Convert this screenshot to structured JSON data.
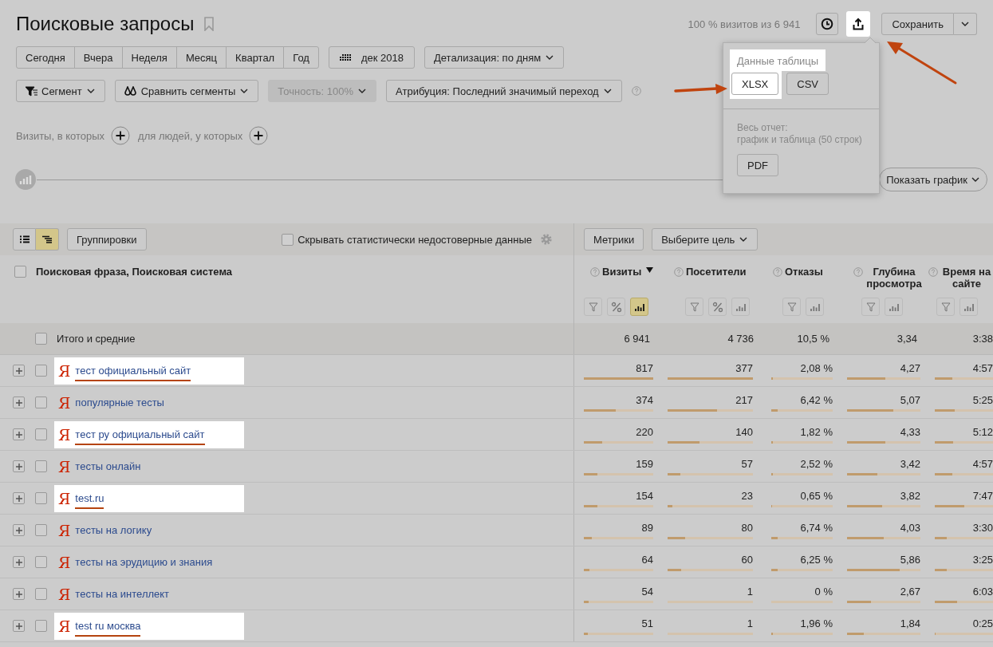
{
  "title": "Поисковые запросы",
  "summary": "100 % визитов из 6 941",
  "export_button": {
    "highlighted": true
  },
  "save_button": "Сохранить",
  "period_tabs": [
    {
      "label": "Сегодня",
      "selected": false
    },
    {
      "label": "Вчера",
      "selected": false
    },
    {
      "label": "Неделя",
      "selected": false
    },
    {
      "label": "Месяц",
      "selected": false
    },
    {
      "label": "Квартал",
      "selected": false
    },
    {
      "label": "Год",
      "selected": false
    }
  ],
  "date_button": "дек 2018",
  "detail_dropdown": "Детализация: по дням",
  "filters": [
    {
      "label": "Сегмент",
      "kind": "segment",
      "disabled": false
    },
    {
      "label": "Сравнить сегменты",
      "kind": "compare",
      "disabled": false
    },
    {
      "label": "Точность: 100%",
      "kind": "plain",
      "disabled": true
    },
    {
      "label": "Атрибуция: Последний значимый переход",
      "kind": "plain",
      "disabled": false
    }
  ],
  "segment_builder": {
    "visits_label": "Визиты, в которых",
    "people_label": "для людей, у которых"
  },
  "chart_toggle": "Показать график",
  "export_menu": {
    "table_title": "Данные таблицы",
    "table_title_highlighted": true,
    "formats": [
      {
        "label": "XLSX",
        "highlighted": true
      },
      {
        "label": "CSV",
        "highlighted": false
      }
    ],
    "report_lines": [
      "Весь отчет:",
      "график и таблица (50 строк)"
    ],
    "report_format": "PDF"
  },
  "table_toolbar": {
    "view_modes": [
      {
        "kind": "list",
        "selected": false
      },
      {
        "kind": "tree",
        "selected": true
      }
    ],
    "groupings_button": "Группировки",
    "hide_unreliable": {
      "label": "Скрывать статистически недостоверные данные",
      "checked": false
    },
    "metrics_button": "Метрики",
    "goal_dropdown": "Выберите цель"
  },
  "table": {
    "select_all_checked": false,
    "dimension_header": "Поисковая фраза, Поисковая система",
    "columns": [
      {
        "label": "Визиты",
        "sorted": true,
        "tools": [
          {
            "kind": "filter",
            "active": false
          },
          {
            "kind": "percent",
            "active": false
          },
          {
            "kind": "bars",
            "active": true
          }
        ]
      },
      {
        "label": "Посетители",
        "sorted": false,
        "tools": [
          {
            "kind": "filter",
            "active": false
          },
          {
            "kind": "percent",
            "active": false
          },
          {
            "kind": "bars",
            "active": false
          }
        ]
      },
      {
        "label": "Отказы",
        "sorted": false,
        "tools": [
          {
            "kind": "filter",
            "active": false
          },
          {
            "kind": "bars",
            "active": false
          }
        ]
      },
      {
        "label": "Глубина просмотра",
        "sorted": false,
        "tools": [
          {
            "kind": "filter",
            "active": false
          },
          {
            "kind": "bars",
            "active": false
          }
        ]
      },
      {
        "label": "Время на сайте",
        "sorted": false,
        "tools": [
          {
            "kind": "filter",
            "active": false
          },
          {
            "kind": "bars",
            "active": false
          }
        ]
      }
    ],
    "totals": {
      "checked": false,
      "label": "Итого и средние",
      "values": [
        "6 941",
        "4 736",
        "10,5 %",
        "3,34",
        "3:38"
      ]
    },
    "rows": [
      {
        "checked": false,
        "engine_icon": "Я",
        "phrase": "тест официальный сайт",
        "annotated": true,
        "cells": [
          {
            "value": "817",
            "level": 1
          },
          {
            "value": "377",
            "level": 1
          },
          {
            "value": "2,08 %",
            "level": 0.03
          },
          {
            "value": "4,27",
            "level": 0.52
          },
          {
            "value": "4:57",
            "level": 0.3
          }
        ]
      },
      {
        "checked": false,
        "engine_icon": "Я",
        "phrase": "популярные тесты",
        "annotated": false,
        "cells": [
          {
            "value": "374",
            "level": 0.46
          },
          {
            "value": "217",
            "level": 0.58
          },
          {
            "value": "6,42 %",
            "level": 0.1
          },
          {
            "value": "5,07",
            "level": 0.63
          },
          {
            "value": "5:25",
            "level": 0.34
          }
        ]
      },
      {
        "checked": false,
        "engine_icon": "Я",
        "phrase": "тест ру официальный сайт",
        "annotated": true,
        "cells": [
          {
            "value": "220",
            "level": 0.27
          },
          {
            "value": "140",
            "level": 0.37
          },
          {
            "value": "1,82 %",
            "level": 0.02
          },
          {
            "value": "4,33",
            "level": 0.52
          },
          {
            "value": "5:12",
            "level": 0.32
          }
        ]
      },
      {
        "checked": false,
        "engine_icon": "Я",
        "phrase": "тесты онлайн",
        "annotated": false,
        "cells": [
          {
            "value": "159",
            "level": 0.19
          },
          {
            "value": "57",
            "level": 0.15
          },
          {
            "value": "2,52 %",
            "level": 0.03
          },
          {
            "value": "3,42",
            "level": 0.41
          },
          {
            "value": "4:57",
            "level": 0.3
          }
        ]
      },
      {
        "checked": false,
        "engine_icon": "Я",
        "phrase": "test.ru",
        "annotated": true,
        "cells": [
          {
            "value": "154",
            "level": 0.19
          },
          {
            "value": "23",
            "level": 0.06
          },
          {
            "value": "0,65 %",
            "level": 0.01
          },
          {
            "value": "3,82",
            "level": 0.48
          },
          {
            "value": "7:47",
            "level": 0.5
          }
        ]
      },
      {
        "checked": false,
        "engine_icon": "Я",
        "phrase": "тесты на логику",
        "annotated": false,
        "cells": [
          {
            "value": "89",
            "level": 0.11
          },
          {
            "value": "80",
            "level": 0.21
          },
          {
            "value": "6,74 %",
            "level": 0.1
          },
          {
            "value": "4,03",
            "level": 0.5
          },
          {
            "value": "3:30",
            "level": 0.21
          }
        ]
      },
      {
        "checked": false,
        "engine_icon": "Я",
        "phrase": "тесты на эрудицию и знания",
        "annotated": false,
        "cells": [
          {
            "value": "64",
            "level": 0.08
          },
          {
            "value": "60",
            "level": 0.16
          },
          {
            "value": "6,25 %",
            "level": 0.1
          },
          {
            "value": "5,86",
            "level": 0.72
          },
          {
            "value": "3:25",
            "level": 0.21
          }
        ]
      },
      {
        "checked": false,
        "engine_icon": "Я",
        "phrase": "тесты на интеллект",
        "annotated": false,
        "cells": [
          {
            "value": "54",
            "level": 0.07
          },
          {
            "value": "1",
            "level": 0
          },
          {
            "value": "0 %",
            "level": 0
          },
          {
            "value": "2,67",
            "level": 0.33
          },
          {
            "value": "6:03",
            "level": 0.39
          }
        ]
      },
      {
        "checked": false,
        "engine_icon": "Я",
        "phrase": "test ru москва",
        "annotated": true,
        "cells": [
          {
            "value": "51",
            "level": 0.06
          },
          {
            "value": "1",
            "level": 0
          },
          {
            "value": "1,96 %",
            "level": 0.02
          },
          {
            "value": "1,84",
            "level": 0.23
          },
          {
            "value": "0:25",
            "level": 0.02
          }
        ]
      }
    ]
  }
}
